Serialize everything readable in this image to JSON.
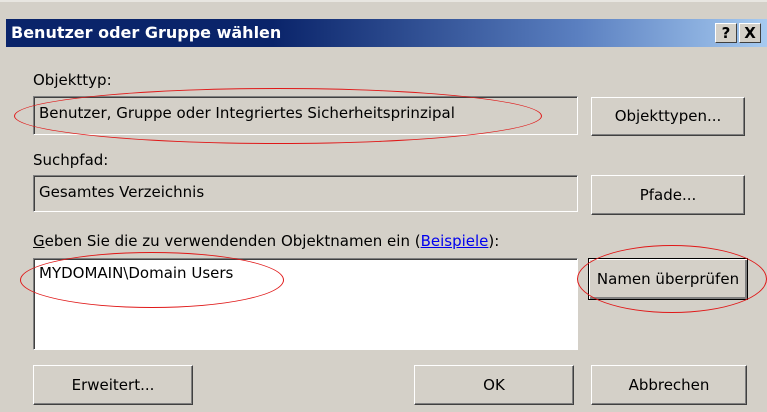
{
  "dialog": {
    "title": "Benutzer oder Gruppe wählen",
    "help_button": "?",
    "close_button": "X"
  },
  "object_type": {
    "label": "Objekttyp:",
    "value": "Benutzer, Gruppe oder Integriertes Sicherheitsprinzipal",
    "button": "Objekttypen..."
  },
  "search_path": {
    "label": "Suchpfad:",
    "value": "Gesamtes Verzeichnis",
    "button": "Pfade..."
  },
  "object_names": {
    "label_prefix": "G",
    "label_rest": "eben Sie die zu verwendenden Objektnamen ein (",
    "examples_link": "Beispiele",
    "label_suffix": "):",
    "value": "MYDOMAIN\\Domain Users",
    "check_button": "Namen überprüfen"
  },
  "footer": {
    "advanced_button": "Erweitert...",
    "ok_button": "OK",
    "cancel_button": "Abbrechen"
  },
  "annotation_color": "#e01818"
}
